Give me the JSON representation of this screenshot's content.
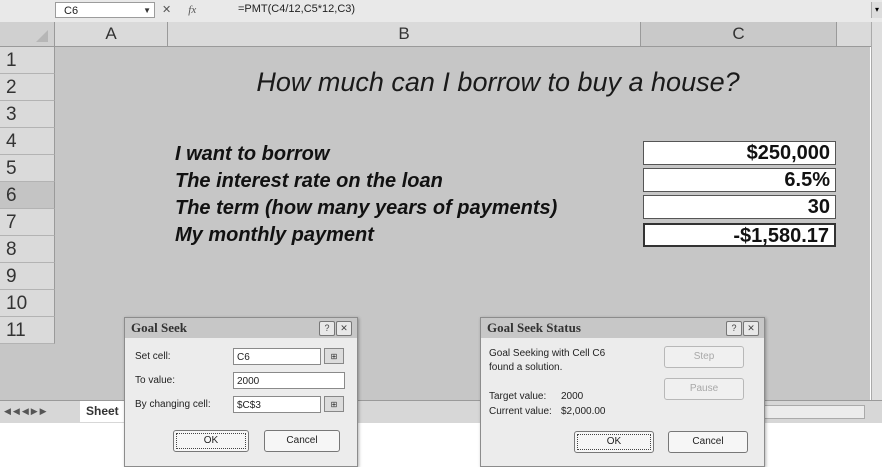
{
  "formula_bar": {
    "name_box": "C6",
    "fx": "fx",
    "formula": "=PMT(C4/12,C5*12,C3)"
  },
  "columns": [
    "A",
    "B",
    "C"
  ],
  "rows": [
    "1",
    "2",
    "3",
    "4",
    "5",
    "6",
    "7",
    "8",
    "9",
    "10",
    "11"
  ],
  "sheet": {
    "title": "How much can I borrow to buy a house?",
    "labels": [
      "I want to borrow",
      "The interest rate on the loan",
      "The term (how many years of payments)",
      "My monthly payment"
    ],
    "values": [
      "$250,000",
      "6.5%",
      "30",
      "-$1,580.17"
    ]
  },
  "tabs": {
    "sheet_tab": "Sheet"
  },
  "goal_seek": {
    "title": "Goal Seek",
    "set_cell_label": "Set cell:",
    "set_cell_value": "C6",
    "to_value_label": "To value:",
    "to_value_value": "2000",
    "by_changing_label": "By changing cell:",
    "by_changing_value": "$C$3",
    "ok": "OK",
    "cancel": "Cancel"
  },
  "goal_seek_status": {
    "title": "Goal Seek Status",
    "message_line1": "Goal Seeking with Cell C6",
    "message_line2": "found a solution.",
    "target_label": "Target value:",
    "target_value": "2000",
    "current_label": "Current value:",
    "current_value": "$2,000.00",
    "step": "Step",
    "pause": "Pause",
    "ok": "OK",
    "cancel": "Cancel"
  }
}
